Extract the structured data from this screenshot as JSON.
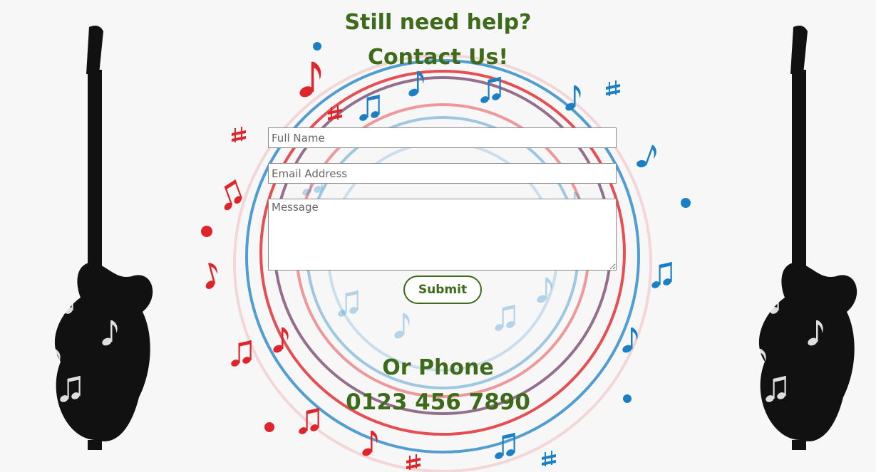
{
  "contact": {
    "heading_help": "Still need help?",
    "heading_contact": "Contact Us!",
    "fields": {
      "name_placeholder": "Full Name",
      "email_placeholder": "Email Address",
      "message_placeholder": "Message"
    },
    "submit_label": "Submit"
  },
  "phone": {
    "heading": "Or Phone",
    "number": "0123 456 7890"
  },
  "colors": {
    "heading_green": "#3d6b1a",
    "swirl_red": "#e0242b",
    "swirl_blue": "#1a7fc4",
    "swirl_purple": "#7a4b6e",
    "guitar_black": "#111111"
  },
  "icons": [
    "music-note-swirl",
    "guitar-icon"
  ]
}
